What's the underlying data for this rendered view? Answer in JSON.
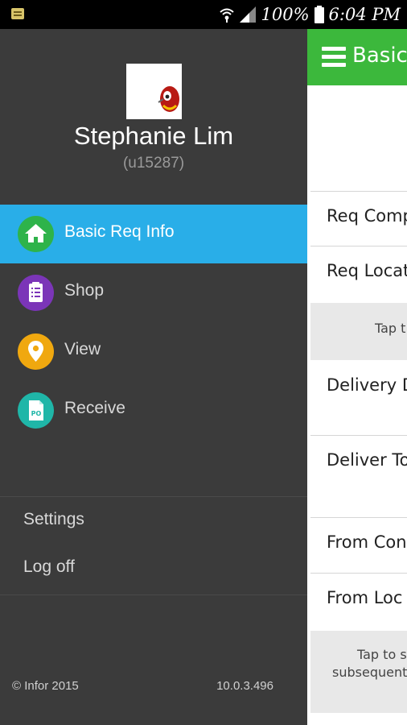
{
  "status_bar": {
    "battery": "100%",
    "time": "6:04 PM",
    "icons": [
      "notification-icon",
      "wifi-icon",
      "signal-icon",
      "battery-icon"
    ]
  },
  "colors": {
    "app_bar": "#3cb83c",
    "active_item": "#29aee8",
    "drawer_bg": "#3b3b3b"
  },
  "drawer": {
    "user": {
      "name": "Stephanie Lim",
      "id": "(u15287)"
    },
    "nav": [
      {
        "label": "Basic Req Info",
        "icon": "home-icon",
        "color": "#2eb34a",
        "active": true
      },
      {
        "label": "Shop",
        "icon": "clipboard-icon",
        "color": "#7b35b8",
        "active": false
      },
      {
        "label": "View",
        "icon": "location-pin-icon",
        "color": "#f0a80f",
        "active": false
      },
      {
        "label": "Receive",
        "icon": "po-document-icon",
        "color": "#1fb6a8",
        "active": false
      }
    ],
    "secondary": [
      {
        "label": "Settings"
      },
      {
        "label": "Log off"
      }
    ],
    "footer": {
      "copyright": "© Infor 2015",
      "version": "10.0.3.496"
    }
  },
  "content": {
    "title": "Basic",
    "rows": [
      {
        "label": "Req Comp"
      },
      {
        "label": "Req Locat"
      },
      {
        "label": "Delivery D"
      },
      {
        "label": "Deliver To"
      },
      {
        "label": "From Con"
      },
      {
        "label": "From Loc"
      }
    ],
    "band1": "Tap t",
    "band2_line1": "Tap to s",
    "band2_line2": "subsequent"
  }
}
